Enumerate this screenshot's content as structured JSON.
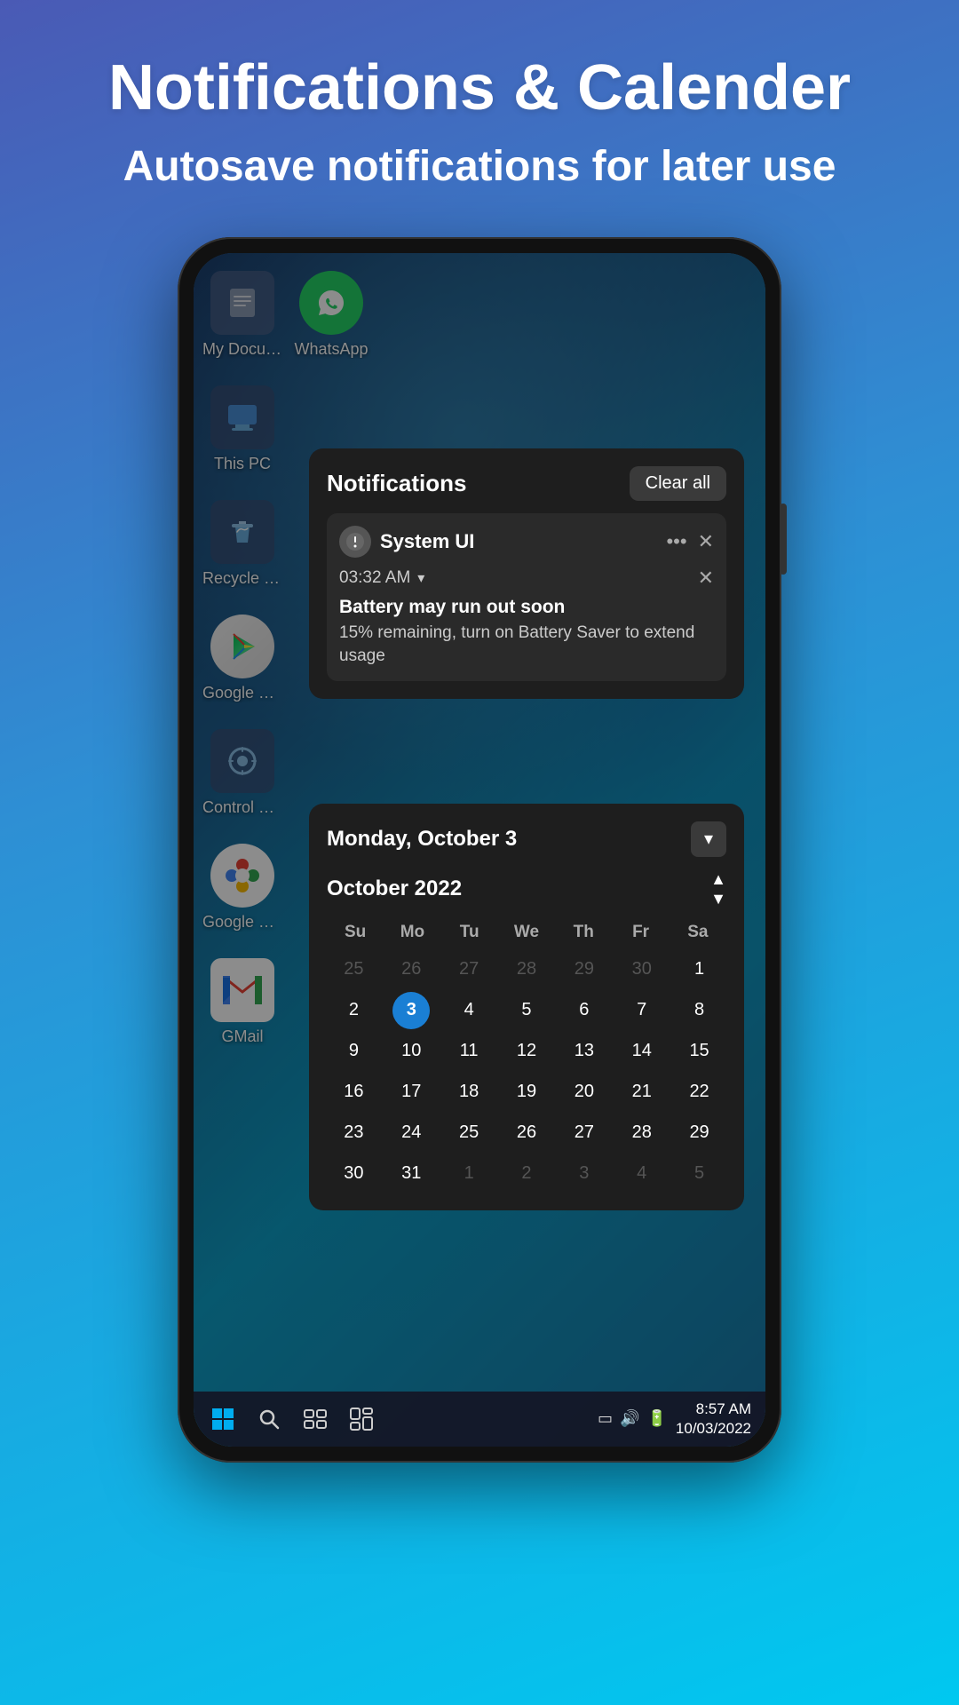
{
  "header": {
    "title": "Notifications & Calender",
    "subtitle": "Autosave notifications for later use"
  },
  "phone": {
    "desktop": {
      "icons": [
        {
          "id": "my-documents",
          "label": "My Docume...",
          "emoji": "📄",
          "bg": "docs"
        },
        {
          "id": "whatsapp",
          "label": "WhatsApp",
          "emoji": "📱",
          "bg": "whatsapp"
        },
        {
          "id": "this-pc",
          "label": "This PC",
          "emoji": "🖥",
          "bg": "thispc"
        },
        {
          "id": "recycle-bin",
          "label": "Recycle bin",
          "emoji": "♻",
          "bg": "recycle"
        },
        {
          "id": "google-play",
          "label": "Google Play",
          "emoji": "▶",
          "bg": "googleplay"
        },
        {
          "id": "control-panel",
          "label": "Control Pane...",
          "emoji": "⚙",
          "bg": "controlpanel"
        },
        {
          "id": "google-photos",
          "label": "Google Pho...",
          "emoji": "🔵",
          "bg": "googlephotos"
        },
        {
          "id": "gmail",
          "label": "GMail",
          "emoji": "✉",
          "bg": "gmail"
        }
      ]
    },
    "notifications": {
      "title": "Notifications",
      "clear_all": "Clear all",
      "item": {
        "app_name": "System UI",
        "time": "03:32 AM",
        "message_title": "Battery may run out soon",
        "message_body": "15% remaining, turn on Battery Saver to extend usage"
      }
    },
    "calendar": {
      "day_label": "Monday, October 3",
      "month_label": "October 2022",
      "weekdays": [
        "Su",
        "Mo",
        "Tu",
        "We",
        "Th",
        "Fr",
        "Sa"
      ],
      "weeks": [
        [
          {
            "n": "25",
            "dim": true
          },
          {
            "n": "26",
            "dim": true
          },
          {
            "n": "27",
            "dim": true
          },
          {
            "n": "28",
            "dim": true
          },
          {
            "n": "29",
            "dim": true
          },
          {
            "n": "30",
            "dim": true
          },
          {
            "n": "1",
            "dim": false
          }
        ],
        [
          {
            "n": "2",
            "dim": false
          },
          {
            "n": "3",
            "dim": false,
            "today": true
          },
          {
            "n": "4",
            "dim": false
          },
          {
            "n": "5",
            "dim": false
          },
          {
            "n": "6",
            "dim": false
          },
          {
            "n": "7",
            "dim": false
          },
          {
            "n": "8",
            "dim": false
          }
        ],
        [
          {
            "n": "9",
            "dim": false
          },
          {
            "n": "10",
            "dim": false
          },
          {
            "n": "11",
            "dim": false
          },
          {
            "n": "12",
            "dim": false
          },
          {
            "n": "13",
            "dim": false
          },
          {
            "n": "14",
            "dim": false
          },
          {
            "n": "15",
            "dim": false
          }
        ],
        [
          {
            "n": "16",
            "dim": false
          },
          {
            "n": "17",
            "dim": false
          },
          {
            "n": "18",
            "dim": false
          },
          {
            "n": "19",
            "dim": false
          },
          {
            "n": "20",
            "dim": false
          },
          {
            "n": "21",
            "dim": false
          },
          {
            "n": "22",
            "dim": false
          }
        ],
        [
          {
            "n": "23",
            "dim": false
          },
          {
            "n": "24",
            "dim": false
          },
          {
            "n": "25",
            "dim": false
          },
          {
            "n": "26",
            "dim": false
          },
          {
            "n": "27",
            "dim": false
          },
          {
            "n": "28",
            "dim": false
          },
          {
            "n": "29",
            "dim": false
          }
        ],
        [
          {
            "n": "30",
            "dim": false
          },
          {
            "n": "31",
            "dim": false
          },
          {
            "n": "1",
            "dim": true
          },
          {
            "n": "2",
            "dim": true
          },
          {
            "n": "3",
            "dim": true
          },
          {
            "n": "4",
            "dim": true
          },
          {
            "n": "5",
            "dim": true
          }
        ]
      ]
    },
    "taskbar": {
      "time": "8:57 AM",
      "date": "10/03/2022"
    }
  }
}
